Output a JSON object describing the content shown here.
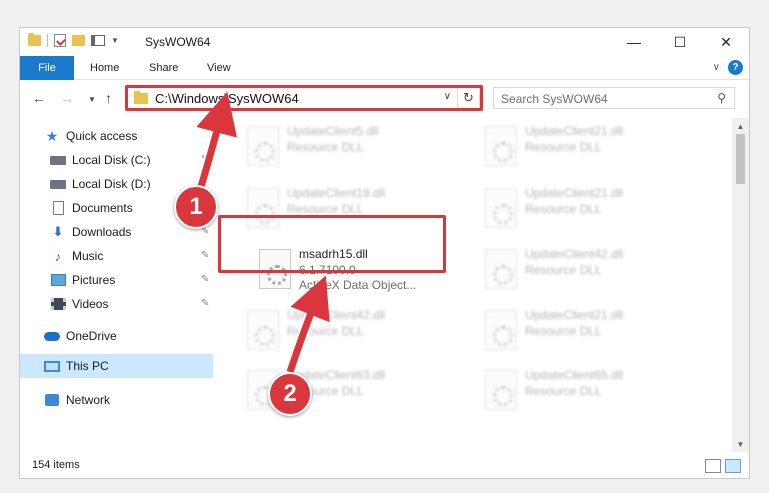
{
  "window": {
    "title": "SysWOW64",
    "controls": {
      "minimize": "—",
      "maximize": "☐",
      "close": "✕"
    }
  },
  "ribbon": {
    "tabs": [
      "File",
      "Home",
      "Share",
      "View"
    ],
    "help": "?"
  },
  "address": {
    "path": "C:\\Windows\\SysWOW64",
    "dropdown": "∨",
    "refresh": "↻"
  },
  "search": {
    "placeholder": "Search SysWOW64"
  },
  "sidebar": {
    "items": [
      {
        "label": "Quick access",
        "icon": "star-icon",
        "pinned": false
      },
      {
        "label": "Local Disk (C:)",
        "icon": "drive-icon",
        "pinned": true
      },
      {
        "label": "Local Disk (D:)",
        "icon": "drive-icon",
        "pinned": false
      },
      {
        "label": "Documents",
        "icon": "document-icon",
        "pinned": true
      },
      {
        "label": "Downloads",
        "icon": "download-icon",
        "pinned": true
      },
      {
        "label": "Music",
        "icon": "music-icon",
        "pinned": true
      },
      {
        "label": "Pictures",
        "icon": "picture-icon",
        "pinned": true
      },
      {
        "label": "Videos",
        "icon": "video-icon",
        "pinned": true
      },
      {
        "label": "OneDrive",
        "icon": "cloud-icon",
        "pinned": false
      },
      {
        "label": "This PC",
        "icon": "computer-icon",
        "pinned": false,
        "selected": true
      },
      {
        "label": "Network",
        "icon": "network-icon",
        "pinned": false
      }
    ]
  },
  "files": {
    "left": [
      {
        "name": "UpdateClient5.dll",
        "type": "Resource DLL"
      },
      {
        "name": "UpdateClient19.dll",
        "type": "Resource DLL"
      },
      {
        "name": "msadrh15.dll",
        "version": "6.1.7100.0",
        "description": "ActiveX Data Object..."
      },
      {
        "name": "UpdateClient42.dll",
        "type": "Resource DLL"
      },
      {
        "name": "UpdateClient63.dll",
        "type": "Resource DLL"
      }
    ],
    "right": [
      {
        "name": "UpdateClient21.dll",
        "type": "Resource DLL"
      },
      {
        "name": "UpdateClient21.dll",
        "type": "Resource DLL"
      },
      {
        "name": "UpdateClient42.dll",
        "type": "Resource DLL"
      },
      {
        "name": "UpdateClient21.dll",
        "type": "Resource DLL"
      },
      {
        "name": "UpdateClient65.dll",
        "type": "Resource DLL"
      }
    ]
  },
  "status": {
    "item_count": "154 items"
  },
  "annotations": {
    "step1": "1",
    "step2": "2"
  },
  "colors": {
    "accent": "#1979ca",
    "highlight": "#d9363e",
    "selection": "#cce8ff"
  }
}
